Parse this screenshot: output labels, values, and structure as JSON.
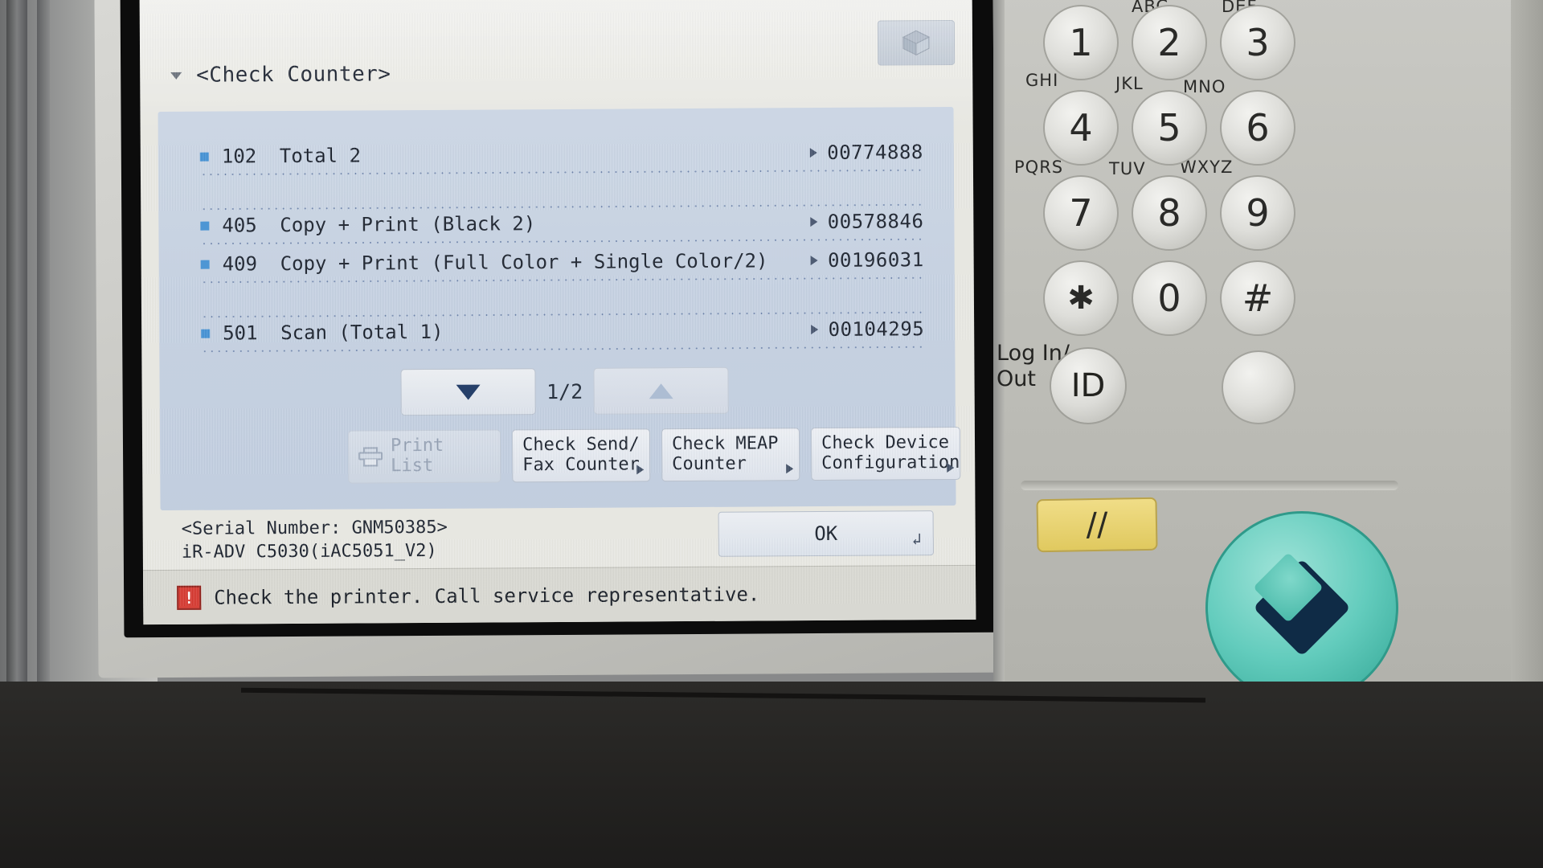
{
  "screen": {
    "title": "<Check Counter>",
    "cube_icon": "cube-icon",
    "counters": [
      {
        "code": "102",
        "label": "Total 2",
        "value": "00774888"
      },
      {
        "code": "405",
        "label": "Copy + Print (Black 2)",
        "value": "00578846"
      },
      {
        "code": "409",
        "label": "Copy + Print (Full Color + Single Color/2)",
        "value": "00196031"
      },
      {
        "code": "501",
        "label": "Scan (Total 1)",
        "value": "00104295"
      }
    ],
    "pager": {
      "down_label": "▼",
      "page_indicator": "1/2",
      "up_label": "▲"
    },
    "buttons": {
      "print_list": "Print List",
      "check_send_fax": "Check Send/\nFax Counter",
      "check_meap": "Check MEAP\nCounter",
      "check_device_config": "Check Device\nConfiguration"
    },
    "footer": {
      "serial": "<Serial Number: GNM50385>",
      "model": "iR-ADV C5030(iAC5051_V2)",
      "ok": "OK",
      "ok_return_glyph": "↲"
    },
    "status_bar": {
      "icon": "service-alert-icon",
      "message": "Check the printer. Call service representative."
    },
    "colors": {
      "bullet_blue": "#3f8fd4",
      "panel_blue": "#c6d2e3",
      "alert_red": "#d6342b",
      "arrow_navy": "#13305f"
    }
  },
  "keypad": {
    "letter_labels_row1": [
      "ABC",
      "DEF"
    ],
    "letter_labels_row2": [
      "GHI",
      "JKL",
      "MNO"
    ],
    "letter_labels_row3": [
      "PQRS",
      "TUV",
      "WXYZ"
    ],
    "keys": [
      "1",
      "2",
      "3",
      "4",
      "5",
      "6",
      "7",
      "8",
      "9",
      "✱",
      "0",
      "#"
    ],
    "login_label": "Log In/",
    "logout_label": "Out",
    "id_key": "ID",
    "reset_key": "//",
    "start_key": "start-key"
  }
}
